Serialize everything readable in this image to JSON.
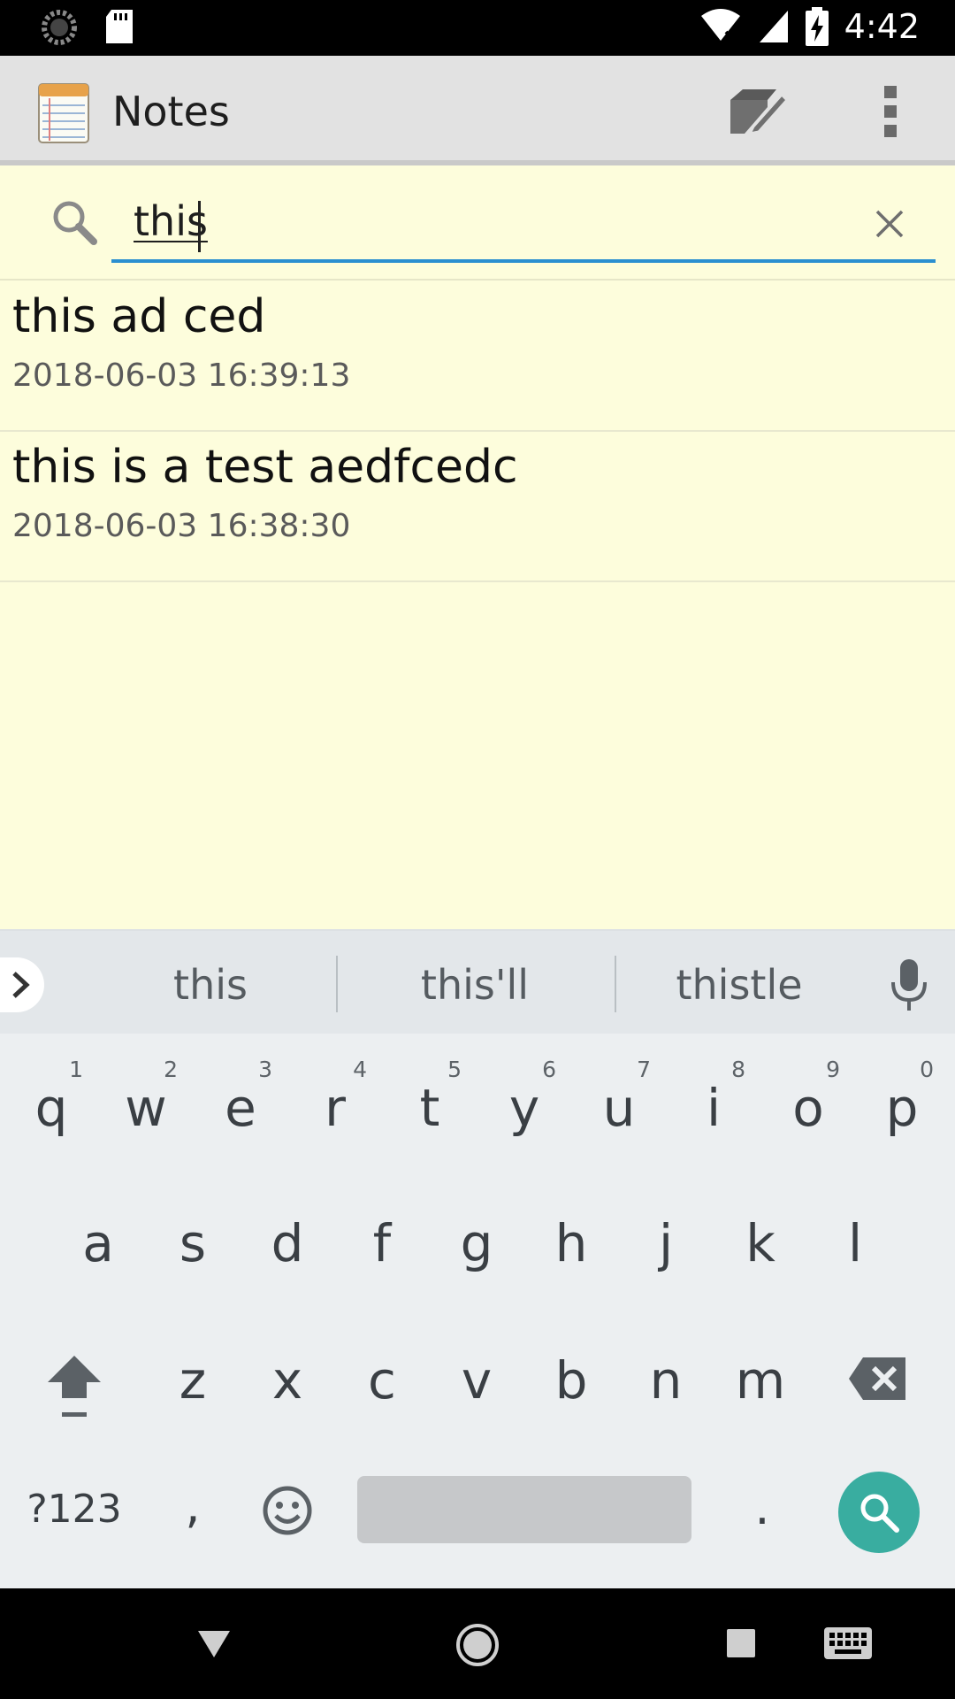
{
  "status_bar": {
    "time": "4:42",
    "icons": [
      "sync-icon",
      "sd-card-icon",
      "wifi-off-icon",
      "signal-icon",
      "battery-charging-icon"
    ]
  },
  "app_bar": {
    "title": "Notes",
    "icons": [
      "notepad-app-icon",
      "new-note-icon",
      "more-vert-icon"
    ]
  },
  "search": {
    "query": "this",
    "icons": [
      "search-icon",
      "clear-icon"
    ],
    "underline_color": "#2b8fd0"
  },
  "notes": [
    {
      "title": "this ad ced",
      "date": "2018-06-03 16:39:13"
    },
    {
      "title": "this is a test aedfcedc",
      "date": "2018-06-03 16:38:30"
    }
  ],
  "keyboard": {
    "suggestions": [
      "this",
      "this'll",
      "thistle"
    ],
    "row1": [
      {
        "key": "q",
        "hint": "1"
      },
      {
        "key": "w",
        "hint": "2"
      },
      {
        "key": "e",
        "hint": "3"
      },
      {
        "key": "r",
        "hint": "4"
      },
      {
        "key": "t",
        "hint": "5"
      },
      {
        "key": "y",
        "hint": "6"
      },
      {
        "key": "u",
        "hint": "7"
      },
      {
        "key": "i",
        "hint": "8"
      },
      {
        "key": "o",
        "hint": "9"
      },
      {
        "key": "p",
        "hint": "0"
      }
    ],
    "row2": [
      "a",
      "s",
      "d",
      "f",
      "g",
      "h",
      "j",
      "k",
      "l"
    ],
    "row3": [
      "z",
      "x",
      "c",
      "v",
      "b",
      "n",
      "m"
    ],
    "symbols_label": "?123",
    "comma": ",",
    "period": ".",
    "action_color": "#39ada0"
  },
  "colors": {
    "background": "#fdfddc",
    "app_bar": "#e2e2e2",
    "keyboard": "#eceff1"
  }
}
